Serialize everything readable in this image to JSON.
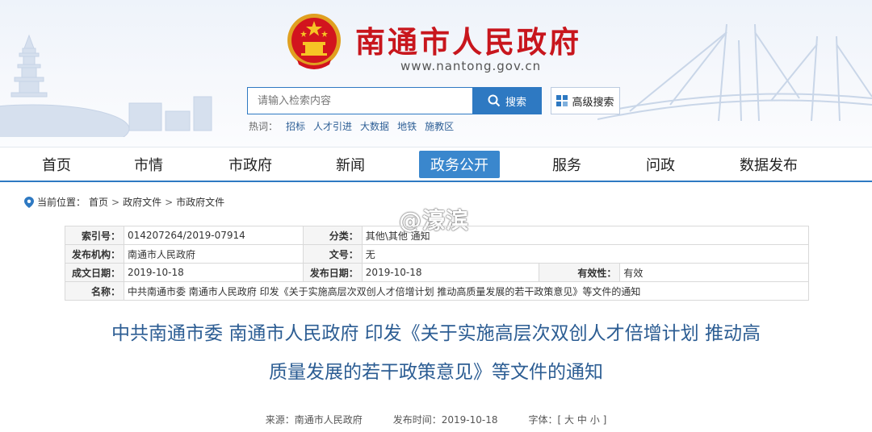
{
  "site": {
    "title": "南通市人民政府",
    "url": "www.nantong.gov.cn"
  },
  "search": {
    "placeholder": "请输入检索内容",
    "button_label": "搜索",
    "advanced_label": "高级搜索",
    "hot_label": "热词：",
    "hot_words": [
      "招标",
      "人才引进",
      "大数据",
      "地铁",
      "施教区"
    ]
  },
  "nav": {
    "items": [
      "首页",
      "市情",
      "市政府",
      "新闻",
      "政务公开",
      "服务",
      "问政",
      "数据发布"
    ],
    "active_index": 4
  },
  "breadcrumb": {
    "label": "当前位置：",
    "items": [
      "首页",
      "政府文件",
      "市政府文件"
    ],
    "separator": ">"
  },
  "watermark": "@濠滨",
  "meta": {
    "index_key": "索引号：",
    "index_val": "014207264/2019-07914",
    "category_key": "分类：",
    "category_val": "其他\\其他   通知",
    "publisher_key": "发布机构：",
    "publisher_val": "南通市人民政府",
    "docno_key": "文号：",
    "docno_val": "无",
    "created_key": "成文日期：",
    "created_val": "2019-10-18",
    "released_key": "发布日期：",
    "released_val": "2019-10-18",
    "validity_key": "有效性：",
    "validity_val": "有效",
    "name_key": "名称：",
    "name_val": "中共南通市委 南通市人民政府 印发《关于实施高层次双创人才倍增计划 推动高质量发展的若干政策意见》等文件的通知"
  },
  "article": {
    "title_line1": "中共南通市委 南通市人民政府 印发《关于实施高层次双创人才倍增计划 推动高",
    "title_line2": "质量发展的若干政策意见》等文件的通知",
    "source": "来源：南通市人民政府",
    "publish_time": "发布时间：2019-10-18",
    "font_label": "字体：[",
    "font_large": "大",
    "font_medium": "中",
    "font_small": "小",
    "font_close": "]"
  },
  "colors": {
    "brand_red": "#c8161d",
    "nav_active": "#3a87cd",
    "primary_blue": "#2e79c2",
    "title_blue": "#2c5d93"
  }
}
